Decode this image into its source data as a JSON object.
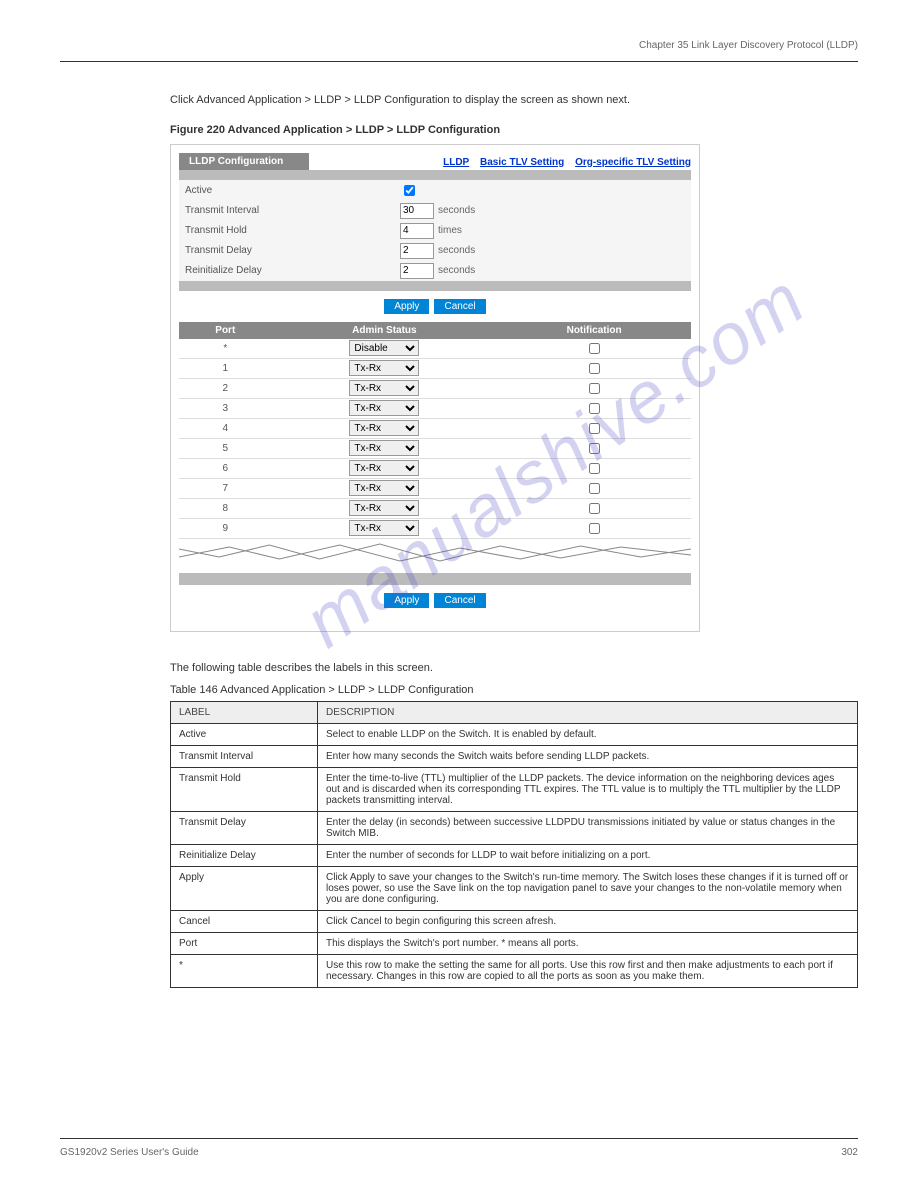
{
  "header": {
    "left": "",
    "right_chapter": "Chapter 35 Link Layer Discovery Protocol (LLDP)"
  },
  "intro": "Click Advanced Application > LLDP > LLDP Configuration to display the screen as shown next.",
  "figure_title": "Figure 220   Advanced Application > LLDP > LLDP Configuration",
  "screenshot": {
    "tab": "LLDP Configuration",
    "links": [
      "LLDP",
      "Basic TLV Setting",
      "Org-specific TLV Setting"
    ],
    "fields": [
      {
        "label": "Active",
        "type": "checkbox",
        "value": true,
        "unit": ""
      },
      {
        "label": "Transmit Interval",
        "type": "text",
        "value": "30",
        "unit": "seconds"
      },
      {
        "label": "Transmit Hold",
        "type": "text",
        "value": "4",
        "unit": "times"
      },
      {
        "label": "Transmit Delay",
        "type": "text",
        "value": "2",
        "unit": "seconds"
      },
      {
        "label": "Reinitialize Delay",
        "type": "text",
        "value": "2",
        "unit": "seconds"
      }
    ],
    "buttons": {
      "apply": "Apply",
      "cancel": "Cancel"
    },
    "port_columns": [
      "Port",
      "Admin Status",
      "Notification"
    ],
    "port_rows": [
      {
        "port": "*",
        "admin": "Disable",
        "notif": false
      },
      {
        "port": "1",
        "admin": "Tx-Rx",
        "notif": false
      },
      {
        "port": "2",
        "admin": "Tx-Rx",
        "notif": false
      },
      {
        "port": "3",
        "admin": "Tx-Rx",
        "notif": false
      },
      {
        "port": "4",
        "admin": "Tx-Rx",
        "notif": false
      },
      {
        "port": "5",
        "admin": "Tx-Rx",
        "notif": false
      },
      {
        "port": "6",
        "admin": "Tx-Rx",
        "notif": false
      },
      {
        "port": "7",
        "admin": "Tx-Rx",
        "notif": false
      },
      {
        "port": "8",
        "admin": "Tx-Rx",
        "notif": false
      },
      {
        "port": "9",
        "admin": "Tx-Rx",
        "notif": false
      }
    ]
  },
  "desc_intro": "The following table describes the labels in this screen.",
  "table_title": "Table 146   Advanced Application > LLDP > LLDP Configuration",
  "desc_table": {
    "head": [
      "LABEL",
      "DESCRIPTION"
    ],
    "rows": [
      {
        "label": "Active",
        "desc": "Select to enable LLDP on the Switch. It is enabled by default."
      },
      {
        "label": "Transmit Interval",
        "desc": "Enter how many seconds the Switch waits before sending LLDP packets."
      },
      {
        "label": "Transmit Hold",
        "desc": "Enter the time-to-live (TTL) multiplier of the LLDP packets. The device information on the neighboring devices ages out and is discarded when its corresponding TTL expires. The TTL value is to multiply the TTL multiplier by the LLDP packets transmitting interval."
      },
      {
        "label": "Transmit Delay",
        "desc": "Enter the delay (in seconds) between successive LLDPDU transmissions initiated by value or status changes in the Switch MIB."
      },
      {
        "label": "Reinitialize Delay",
        "desc": "Enter the number of seconds for LLDP to wait before initializing on a port."
      },
      {
        "label": "Apply",
        "desc": "Click Apply to save your changes to the Switch's run-time memory. The Switch loses these changes if it is turned off or loses power, so use the Save link on the top navigation panel to save your changes to the non-volatile memory when you are done configuring."
      },
      {
        "label": "Cancel",
        "desc": "Click Cancel to begin configuring this screen afresh."
      },
      {
        "label": "Port",
        "desc": "This displays the Switch's port number. * means all ports."
      },
      {
        "label": "*",
        "desc": "Use this row to make the setting the same for all ports. Use this row first and then make adjustments to each port if necessary.\nChanges in this row are copied to all the ports as soon as you make them."
      }
    ]
  },
  "footer": {
    "left": "GS1920v2 Series User's Guide",
    "right": "302"
  },
  "watermark": "manualshive.com"
}
